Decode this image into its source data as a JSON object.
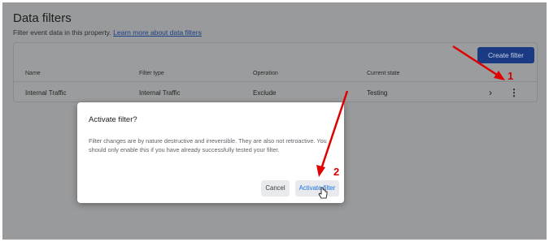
{
  "page": {
    "title": "Data filters",
    "subtitle_text": "Filter event data in this property.",
    "subtitle_link": "Learn more about data filters",
    "create_button": "Create filter"
  },
  "table": {
    "headers": [
      "Name",
      "Filter type",
      "Operation",
      "Current state"
    ],
    "rows": [
      {
        "name": "Internal Traffic",
        "filter_type": "Internal Traffic",
        "operation": "Exclude",
        "state": "Testing"
      }
    ]
  },
  "dialog": {
    "title": "Activate filter?",
    "body": "Filter changes are by nature destructive and irreversible. They are also not retroactive. You should only enable this if you have already successfully tested your filter.",
    "cancel": "Cancel",
    "confirm": "Activate filter"
  },
  "annotations": {
    "step1": "1",
    "step2": "2"
  },
  "colors": {
    "arrow": "#e00000",
    "primary_button": "#1a3a84",
    "link": "#1a73e8",
    "page_dimmed": "#999a9b"
  },
  "icons": {
    "row_open": "chevron-right-icon",
    "row_menu": "more-vert-icon",
    "cursor": "hand-pointer-icon"
  }
}
